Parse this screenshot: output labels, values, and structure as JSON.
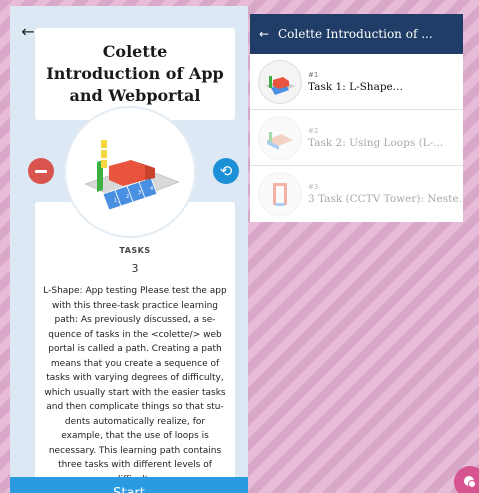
{
  "left": {
    "title": "Colette Introduction of App and Webportal",
    "tasks_label": "TASKS",
    "tasks_count": "3",
    "description": "L-Shape: App testing Please test the app with this three-task practice learning path: As previously discussed, a se-quence of tasks in the <colette/> web portal is called a path. Creating a path means that you create a sequence of tasks with varying degrees of difficulty, which usually start with the easier tasks and then complicate things so that stu-dents automatically realize, for example, that the use of loops is necessary. This learning path contains three tasks with different levels of difficulty.",
    "start_label": "Start"
  },
  "right": {
    "header_title": "Colette Introduction of ...",
    "tasks": [
      {
        "num": "#1",
        "title": "Task 1: L-Shape..."
      },
      {
        "num": "#2",
        "title": "Task 2: Using Loops (L-..."
      },
      {
        "num": "#3",
        "title": "3 Task (CCTV Tower): Neste..."
      }
    ]
  },
  "colors": {
    "header_bg": "#1f3d66",
    "start_bg": "#2a9be0",
    "minus_bg": "#d9534f",
    "refresh_bg": "#1e90d8",
    "fab_bg": "#d6548f",
    "panel_bg": "#dce8f3"
  },
  "icons": {
    "back": "arrow-left-icon",
    "remove": "minus-icon",
    "refresh": "refresh-icon",
    "fab": "chat-bubble-icon"
  }
}
